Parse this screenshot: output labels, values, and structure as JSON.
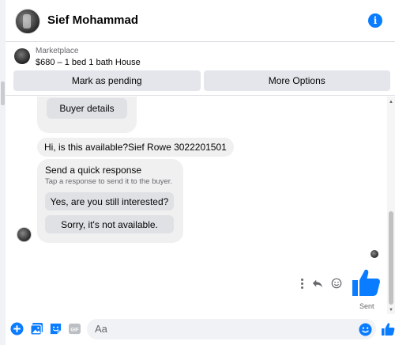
{
  "header": {
    "contact_name": "Sief Mohammad",
    "avatar_icon": "profile-photo",
    "info_icon": "info-icon",
    "info_glyph": "i"
  },
  "marketplace": {
    "label": "Marketplace",
    "item": "$680 – 1 bed 1 bath House",
    "buttons": {
      "mark_pending": "Mark as pending",
      "more_options": "More Options"
    }
  },
  "messages": {
    "buyer_details_button": "Buyer details",
    "incoming_text": "Hi, is this available?Sief Rowe 3022201501",
    "quick_response": {
      "title": "Send a quick response",
      "subtitle": "Tap a response to send it to the buyer.",
      "options": [
        "Yes, are you still interested?",
        "Sorry, it's not available."
      ]
    },
    "status": "Sent"
  },
  "composer": {
    "placeholder": "Aa",
    "icons": [
      "add-icon",
      "photo-icon",
      "sticker-icon",
      "gif-icon",
      "emoji-icon",
      "like-icon"
    ],
    "gif_label": "GIF"
  },
  "colors": {
    "accent": "#0a7cff",
    "bubble": "#f0f0f0",
    "button": "#e4e6eb"
  }
}
